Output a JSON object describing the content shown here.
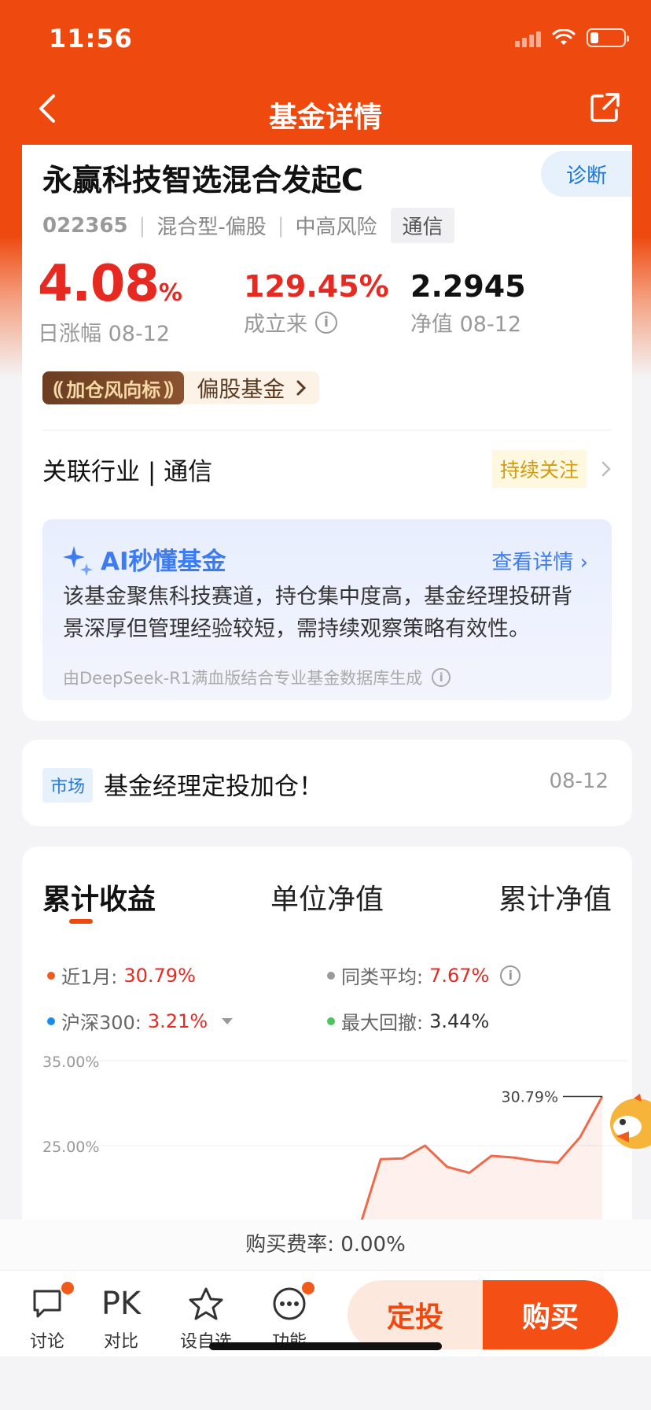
{
  "status_bar": {
    "time": "11:56"
  },
  "nav": {
    "title": "基金详情"
  },
  "fund": {
    "name": "永赢科技智选混合发起C",
    "code": "022365",
    "type": "混合型-偏股",
    "risk": "中高风险",
    "sector_tag": "通信",
    "diagnose_label": "诊断"
  },
  "stats": {
    "daily_change": "4.08",
    "daily_change_unit": "%",
    "daily_change_label": "日涨幅 08-12",
    "since_inception": "129.45%",
    "since_inception_label": "成立来",
    "nav_value": "2.2945",
    "nav_label": "净值 08-12"
  },
  "badge": {
    "dark_label": "加仓风向标",
    "light_label": "偏股基金"
  },
  "industry": {
    "label": "关联行业 | 通信",
    "follow_label": "持续关注"
  },
  "ai_summary": {
    "title": "AI秒懂基金",
    "link": "查看详情",
    "text": "该基金聚焦科技赛道，持仓集中度高，基金经理投研背景深厚但管理经验较短，需持续观察策略有效性。",
    "footer": "由DeepSeek-R1满血版结合专业基金数据库生成"
  },
  "news": {
    "tag": "市场",
    "title": "基金经理定投加仓！",
    "date": "08-12"
  },
  "chart_tabs": [
    "累计收益",
    "单位净值",
    "累计净值"
  ],
  "legend": {
    "m1_label": "近1月:",
    "m1_value": "30.79%",
    "avg_label": "同类平均:",
    "avg_value": "7.67%",
    "hs300_label": "沪深300:",
    "hs300_value": "3.21%",
    "drawdown_label": "最大回撤:",
    "drawdown_value": "3.44%"
  },
  "colors": {
    "accent": "#ee4a10",
    "up": "#e62a22",
    "fund_line": "#ee6a4a",
    "avg_dot": "#999999",
    "hs300_dot": "#1a8cf0",
    "drawdown_dot": "#4cc25a"
  },
  "chart_data": {
    "type": "area",
    "ytick_labels": [
      "35.00%",
      "25.00%"
    ],
    "y_ticks": [
      35,
      25
    ],
    "ylim": [
      15,
      35
    ],
    "end_label": "30.79%",
    "series": [
      {
        "values": [
          15.0,
          23.4,
          23.5,
          25.0,
          22.5,
          21.8,
          23.8,
          23.6,
          23.2,
          23.0,
          26.0,
          30.79
        ]
      }
    ],
    "grid": true
  },
  "fee": {
    "label": "购买费率: 0.00%"
  },
  "bottom_bar": {
    "discuss": "讨论",
    "compare_icon": "PK",
    "compare": "对比",
    "watchlist": "设自选",
    "functions": "功能",
    "auto_invest": "定投",
    "buy": "购买"
  }
}
